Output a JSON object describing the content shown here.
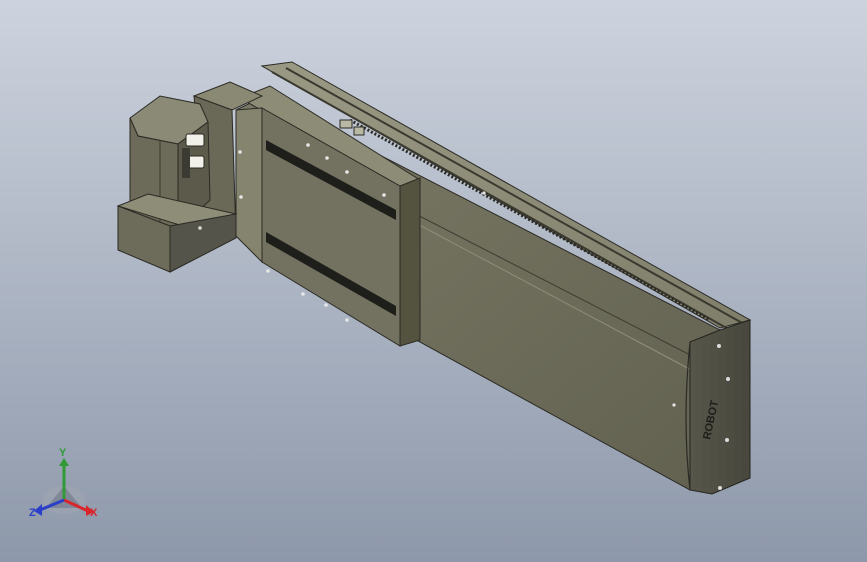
{
  "viewport": {
    "background_top": "#c9d0dc",
    "background_bottom": "#8f9aab",
    "model_color": "#6f6e5c"
  },
  "model": {
    "parts": [
      "linear-actuator-rail",
      "sliding-carriage",
      "servo-motor",
      "motor-reducer-box",
      "end-cap"
    ],
    "end_cap_logo": "ROBOT"
  },
  "triad": {
    "x_label": "X",
    "y_label": "Y",
    "z_label": "Z",
    "x_color": "#d8262c",
    "y_color": "#2f9a36",
    "z_color": "#2b3fc9"
  }
}
